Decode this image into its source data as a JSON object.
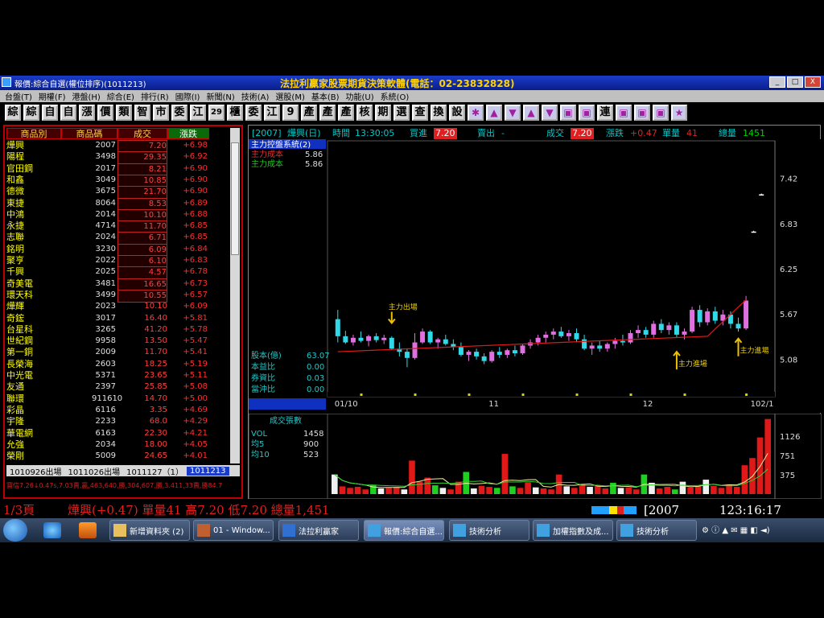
{
  "window": {
    "title": "報價:綜合自選(權位排序)(1011213)",
    "promo": "法拉利贏家股票期貨決策軟體(電話：02-23832828)",
    "buttons": [
      "_",
      "□",
      "X"
    ]
  },
  "menu": [
    "台盤(T)",
    "期權(F)",
    "港盤(H)",
    "綜合(E)",
    "排行(R)",
    "國際(I)",
    "新聞(N)",
    "技術(A)",
    "選股(M)",
    "基本(B)",
    "功能(U)",
    "系統(O)"
  ],
  "toolbar": [
    "綜",
    "綜",
    "自",
    "自",
    "漲",
    "價",
    "類",
    "智",
    "市",
    "委",
    "江",
    "29",
    "櫃",
    "委",
    "江",
    "9",
    "產",
    "產",
    "產",
    "核",
    "期",
    "選",
    "查",
    "換",
    "設",
    "✱",
    "▲",
    "▼",
    "▲",
    "▼",
    "▣",
    "▣",
    "連",
    "▣",
    "▣",
    "▣",
    "★"
  ],
  "quote_table": {
    "headers": [
      "商品別",
      "商品碼",
      "成交",
      "漲跌"
    ],
    "rows": [
      {
        "name": "燁興",
        "code": "2007",
        "price": "7.20",
        "change": "+6.98"
      },
      {
        "name": "陽程",
        "code": "3498",
        "price": "29.35",
        "change": "+6.92"
      },
      {
        "name": "官田鋼",
        "code": "2017",
        "price": "8.21",
        "change": "+6.90"
      },
      {
        "name": "和鑫",
        "code": "3049",
        "price": "10.85",
        "change": "+6.90"
      },
      {
        "name": "德微",
        "code": "3675",
        "price": "21.70",
        "change": "+6.90"
      },
      {
        "name": "東捷",
        "code": "8064",
        "price": "8.53",
        "change": "+6.89"
      },
      {
        "name": "中鴻",
        "code": "2014",
        "price": "10.10",
        "change": "+6.88"
      },
      {
        "name": "永捷",
        "code": "4714",
        "price": "11.70",
        "change": "+6.85"
      },
      {
        "name": "志聯",
        "code": "2024",
        "price": "6.71",
        "change": "+6.85"
      },
      {
        "name": "銘明",
        "code": "3230",
        "price": "6.09",
        "change": "+6.84"
      },
      {
        "name": "聚亨",
        "code": "2022",
        "price": "6.10",
        "change": "+6.83"
      },
      {
        "name": "千興",
        "code": "2025",
        "price": "4.57",
        "change": "+6.78"
      },
      {
        "name": "奇美電",
        "code": "3481",
        "price": "16.65",
        "change": "+6.73"
      },
      {
        "name": "環天科",
        "code": "3499",
        "price": "10.55",
        "change": "+6.57"
      },
      {
        "name": "燁輝",
        "code": "2023",
        "price": "10.10",
        "change": "+6.09"
      },
      {
        "name": "奇鋐",
        "code": "3017",
        "price": "16.40",
        "change": "+5.81"
      },
      {
        "name": "台星科",
        "code": "3265",
        "price": "41.20",
        "change": "+5.78"
      },
      {
        "name": "世紀鋼",
        "code": "9958",
        "price": "13.50",
        "change": "+5.47"
      },
      {
        "name": "第一銅",
        "code": "2009",
        "price": "11.70",
        "change": "+5.41"
      },
      {
        "name": "長榮海",
        "code": "2603",
        "price": "18.25",
        "change": "+5.19"
      },
      {
        "name": "中光電",
        "code": "5371",
        "price": "23.65",
        "change": "+5.11"
      },
      {
        "name": "友通",
        "code": "2397",
        "price": "25.85",
        "change": "+5.08"
      },
      {
        "name": "聯環",
        "code": "911610",
        "price": "14.70",
        "change": "+5.00"
      },
      {
        "name": "彩晶",
        "code": "6116",
        "price": "3.35",
        "change": "+4.69"
      },
      {
        "name": "宇隆",
        "code": "2233",
        "price": "68.0",
        "change": "+4.29"
      },
      {
        "name": "華電網",
        "code": "6163",
        "price": "22.30",
        "change": "+4.21"
      },
      {
        "name": "允強",
        "code": "2034",
        "price": "18.00",
        "change": "+4.05"
      },
      {
        "name": "榮剛",
        "code": "5009",
        "price": "24.65",
        "change": "+4.01"
      }
    ],
    "tabs": [
      "1010926出場",
      "1011026出場",
      "1011127（1）",
      "1011213"
    ],
    "ticker": "寶信7.26↓0.47s,7.03賣,贏,463,640,勝,304,607,勝,3.411,33賣,勝84.7"
  },
  "stock_header": {
    "code": "[2007]",
    "name": "燁興(日)",
    "time_label": "時間",
    "time": "13:30:05",
    "bid_label": "買進",
    "bid": "7.20",
    "ask_label": "賣出",
    "ask": "-",
    "last_label": "成交",
    "last": "7.20",
    "chg_label": "漲跌",
    "chg": "+0.47",
    "vol_label": "單量",
    "vol": "41",
    "total_label": "總量",
    "total": "1451"
  },
  "indicator_panel": {
    "title": "主力控盤系統(2)",
    "line1_label": "主力成本",
    "line1_value": "5.86",
    "line2_label": "主力成本",
    "line2_value": "5.86",
    "stats": [
      {
        "label": "股本(億)",
        "value": "63.07"
      },
      {
        "label": "本益比",
        "value": "0.00"
      },
      {
        "label": "券資比",
        "value": "0.03"
      },
      {
        "label": "當沖比",
        "value": "0.00"
      }
    ]
  },
  "chart_data": [
    {
      "type": "candlestick",
      "title": "燁興(日)",
      "y_ticks": [
        "7.42",
        "6.83",
        "6.25",
        "5.67",
        "5.08"
      ],
      "ylim": [
        4.6,
        7.9
      ],
      "x_ticks": [
        "01/10",
        "11",
        "12",
        "102/1"
      ],
      "annotations": [
        "主力出場",
        "主力進場",
        "主力進場"
      ],
      "candles": [
        {
          "o": 5.6,
          "h": 5.72,
          "l": 5.3,
          "c": 5.38
        },
        {
          "o": 5.38,
          "h": 5.45,
          "l": 5.28,
          "c": 5.3
        },
        {
          "o": 5.3,
          "h": 5.4,
          "l": 5.26,
          "c": 5.36
        },
        {
          "o": 5.36,
          "h": 5.44,
          "l": 5.3,
          "c": 5.32
        },
        {
          "o": 5.32,
          "h": 5.4,
          "l": 5.25,
          "c": 5.38
        },
        {
          "o": 5.38,
          "h": 5.42,
          "l": 5.3,
          "c": 5.33
        },
        {
          "o": 5.33,
          "h": 5.4,
          "l": 5.28,
          "c": 5.36
        },
        {
          "o": 5.36,
          "h": 5.38,
          "l": 5.2,
          "c": 5.22
        },
        {
          "o": 5.22,
          "h": 5.3,
          "l": 5.12,
          "c": 5.18
        },
        {
          "o": 5.18,
          "h": 5.22,
          "l": 4.98,
          "c": 5.1
        },
        {
          "o": 5.1,
          "h": 5.42,
          "l": 5.08,
          "c": 5.3
        },
        {
          "o": 5.3,
          "h": 5.48,
          "l": 5.28,
          "c": 5.44
        },
        {
          "o": 5.44,
          "h": 5.46,
          "l": 5.28,
          "c": 5.3
        },
        {
          "o": 5.3,
          "h": 5.36,
          "l": 5.22,
          "c": 5.34
        },
        {
          "o": 5.34,
          "h": 5.4,
          "l": 5.26,
          "c": 5.28
        },
        {
          "o": 5.28,
          "h": 5.34,
          "l": 5.2,
          "c": 5.24
        },
        {
          "o": 5.24,
          "h": 5.3,
          "l": 5.12,
          "c": 5.14
        },
        {
          "o": 5.14,
          "h": 5.2,
          "l": 5.06,
          "c": 5.18
        },
        {
          "o": 5.18,
          "h": 5.22,
          "l": 5.08,
          "c": 5.12
        },
        {
          "o": 5.12,
          "h": 5.16,
          "l": 5.02,
          "c": 5.06
        },
        {
          "o": 5.06,
          "h": 5.2,
          "l": 5.04,
          "c": 5.18
        },
        {
          "o": 5.18,
          "h": 5.24,
          "l": 5.1,
          "c": 5.14
        },
        {
          "o": 5.14,
          "h": 5.22,
          "l": 5.1,
          "c": 5.2
        },
        {
          "o": 5.2,
          "h": 5.26,
          "l": 5.12,
          "c": 5.16
        },
        {
          "o": 5.16,
          "h": 5.28,
          "l": 5.14,
          "c": 5.26
        },
        {
          "o": 5.26,
          "h": 5.34,
          "l": 5.22,
          "c": 5.3
        },
        {
          "o": 5.3,
          "h": 5.4,
          "l": 5.26,
          "c": 5.36
        },
        {
          "o": 5.36,
          "h": 5.44,
          "l": 5.3,
          "c": 5.4
        },
        {
          "o": 5.4,
          "h": 5.48,
          "l": 5.34,
          "c": 5.44
        },
        {
          "o": 5.44,
          "h": 5.5,
          "l": 5.36,
          "c": 5.38
        },
        {
          "o": 5.38,
          "h": 5.46,
          "l": 5.32,
          "c": 5.42
        },
        {
          "o": 5.42,
          "h": 5.48,
          "l": 5.3,
          "c": 5.34
        },
        {
          "o": 5.34,
          "h": 5.4,
          "l": 5.2,
          "c": 5.22
        },
        {
          "o": 5.22,
          "h": 5.3,
          "l": 5.14,
          "c": 5.26
        },
        {
          "o": 5.26,
          "h": 5.32,
          "l": 5.18,
          "c": 5.22
        },
        {
          "o": 5.22,
          "h": 5.3,
          "l": 5.18,
          "c": 5.28
        },
        {
          "o": 5.28,
          "h": 5.36,
          "l": 5.22,
          "c": 5.32
        },
        {
          "o": 5.32,
          "h": 5.4,
          "l": 5.26,
          "c": 5.3
        },
        {
          "o": 5.3,
          "h": 5.46,
          "l": 5.28,
          "c": 5.42
        },
        {
          "o": 5.42,
          "h": 5.52,
          "l": 5.36,
          "c": 5.46
        },
        {
          "o": 5.46,
          "h": 5.5,
          "l": 5.36,
          "c": 5.4
        },
        {
          "o": 5.4,
          "h": 5.58,
          "l": 5.36,
          "c": 5.54
        },
        {
          "o": 5.54,
          "h": 5.6,
          "l": 5.42,
          "c": 5.46
        },
        {
          "o": 5.46,
          "h": 5.56,
          "l": 5.4,
          "c": 5.52
        },
        {
          "o": 5.52,
          "h": 5.56,
          "l": 5.36,
          "c": 5.4
        },
        {
          "o": 5.4,
          "h": 5.48,
          "l": 5.34,
          "c": 5.44
        },
        {
          "o": 5.44,
          "h": 5.76,
          "l": 5.42,
          "c": 5.72
        },
        {
          "o": 5.72,
          "h": 5.78,
          "l": 5.5,
          "c": 5.56
        },
        {
          "o": 5.56,
          "h": 5.74,
          "l": 5.52,
          "c": 5.7
        },
        {
          "o": 5.7,
          "h": 5.76,
          "l": 5.54,
          "c": 5.58
        },
        {
          "o": 5.58,
          "h": 5.72,
          "l": 5.52,
          "c": 5.66
        },
        {
          "o": 5.66,
          "h": 5.7,
          "l": 5.48,
          "c": 5.54
        },
        {
          "o": 5.54,
          "h": 5.62,
          "l": 5.44,
          "c": 5.48
        },
        {
          "o": 5.48,
          "h": 5.9,
          "l": 5.46,
          "c": 5.84
        },
        {
          "o": 6.72,
          "h": 6.74,
          "l": 6.72,
          "c": 6.73
        },
        {
          "o": 7.2,
          "h": 7.22,
          "l": 7.2,
          "c": 7.21
        }
      ]
    },
    {
      "type": "bar",
      "title": "成交張數",
      "y_ticks": [
        "1126",
        "751",
        "375"
      ],
      "ylim": [
        0,
        1500
      ],
      "series": [
        {
          "name": "VOL",
          "value": "1458"
        },
        {
          "name": "均5",
          "value": "900"
        },
        {
          "name": "均10",
          "value": "523"
        }
      ],
      "values": [
        380,
        150,
        120,
        140,
        90,
        180,
        110,
        120,
        140,
        90,
        650,
        240,
        320,
        170,
        120,
        90,
        240,
        430,
        110,
        160,
        140,
        120,
        780,
        150,
        120,
        230,
        130,
        110,
        90,
        380,
        150,
        120,
        200,
        140,
        160,
        110,
        220,
        120,
        130,
        90,
        380,
        220,
        110,
        140,
        90,
        240,
        130,
        150,
        280,
        160,
        120,
        190,
        140,
        560,
        700,
        1100,
        1458
      ]
    }
  ],
  "status_bar": {
    "page": "1/3頁",
    "summary": "燁興(+0.47) 單量41 高7.20 低7.20 總量1,451",
    "code": "[2007",
    "clock": "123:16:17"
  },
  "taskbar": {
    "items": [
      "新增資料夾 (2)",
      "01 - Window...",
      "法拉利贏家",
      "報價:綜合自選...",
      "技術分析",
      "加權指數及成...",
      "技術分析"
    ],
    "active_index": 3
  }
}
